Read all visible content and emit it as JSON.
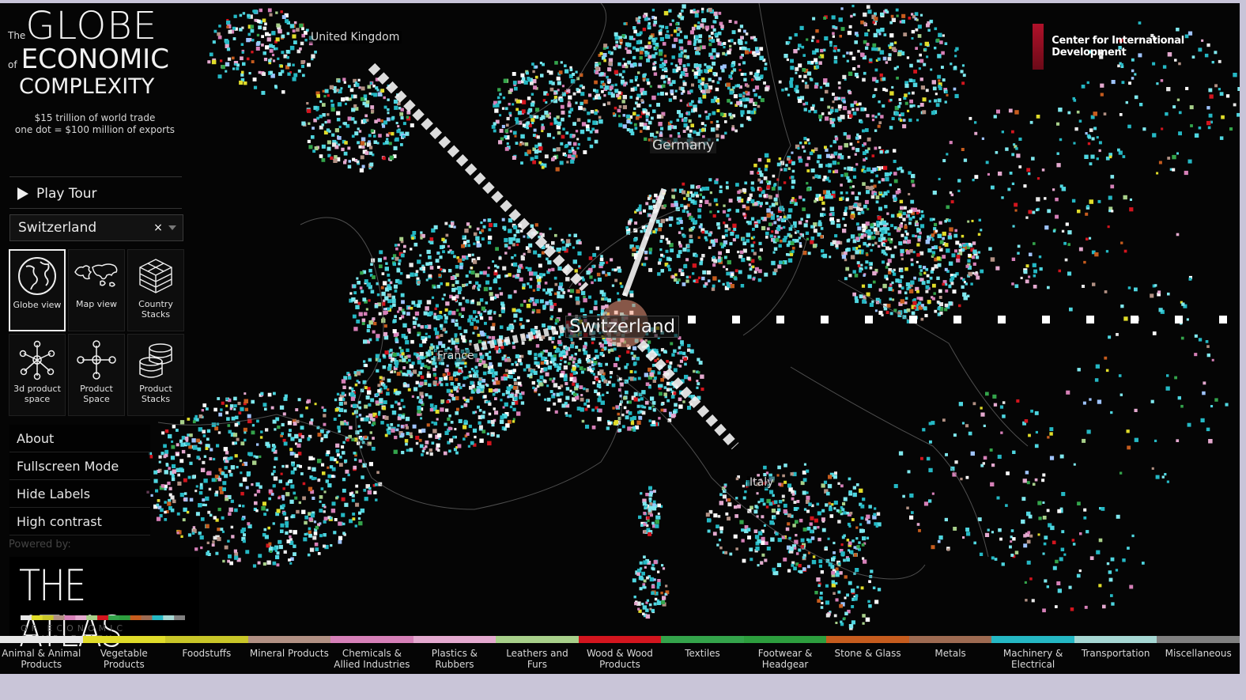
{
  "title": {
    "the": "The",
    "globe": "GLOBE",
    "of": "of",
    "economic": "ECONOMIC",
    "complexity": "COMPLEXITY",
    "subtitle_line1": "$15 trillion of world trade",
    "subtitle_line2": "one dot = $100 million of exports"
  },
  "sidebar": {
    "play_tour": "Play Tour",
    "country_select": {
      "value": "Switzerland",
      "clear": "×"
    },
    "views": [
      {
        "label": "Globe view",
        "icon": "globe-icon",
        "active": true
      },
      {
        "label": "Map view",
        "icon": "world-map-icon",
        "active": false
      },
      {
        "label": "Country\nStacks",
        "icon": "cube-stack-icon",
        "active": false
      },
      {
        "label": "3d product\nspace",
        "icon": "network-3d-icon",
        "active": false
      },
      {
        "label": "Product\nSpace",
        "icon": "network-icon",
        "active": false
      },
      {
        "label": "Product\nStacks",
        "icon": "coin-stack-icon",
        "active": false
      }
    ],
    "menu": [
      {
        "label": "About"
      },
      {
        "label": "Fullscreen Mode"
      },
      {
        "label": "Hide Labels"
      },
      {
        "label": "High contrast"
      }
    ],
    "powered_by": "Powered by:",
    "atlas": {
      "main": "THE ATLAS",
      "sub": "OF ECONOMIC COMPLEXITY"
    }
  },
  "branding": {
    "cid": "Center for International Development"
  },
  "map": {
    "labels": [
      {
        "text": "United Kingdom",
        "style": "small"
      },
      {
        "text": "Germany",
        "style": "mid"
      },
      {
        "text": "Switzerland",
        "style": "big"
      },
      {
        "text": "France",
        "style": "small"
      },
      {
        "text": "Italy",
        "style": "small"
      }
    ]
  },
  "categories": [
    {
      "label": "Animal & Animal\nProducts",
      "color": "#e7e7e7"
    },
    {
      "label": "Vegetable\nProducts",
      "color": "#e0dc2a"
    },
    {
      "label": "Foodstuffs",
      "color": "#c9c628"
    },
    {
      "label": "Mineral Products",
      "color": "#b29184"
    },
    {
      "label": "Chemicals &\nAllied Industries",
      "color": "#d680b8"
    },
    {
      "label": "Plastics &\nRubbers",
      "color": "#e4a9cf"
    },
    {
      "label": "Leathers and\nFurs",
      "color": "#a8d08a"
    },
    {
      "label": "Wood & Wood\nProducts",
      "color": "#d3151e"
    },
    {
      "label": "Textiles",
      "color": "#34a44b"
    },
    {
      "label": "Footwear &\nHeadgear",
      "color": "#2d9e3e"
    },
    {
      "label": "Stone & Glass",
      "color": "#c65c1e"
    },
    {
      "label": "Metals",
      "color": "#9e6b52"
    },
    {
      "label": "Machinery &\nElectrical",
      "color": "#25b8c4"
    },
    {
      "label": "Transportation",
      "color": "#a6d7d3"
    },
    {
      "label": "Miscellaneous",
      "color": "#808080"
    }
  ]
}
